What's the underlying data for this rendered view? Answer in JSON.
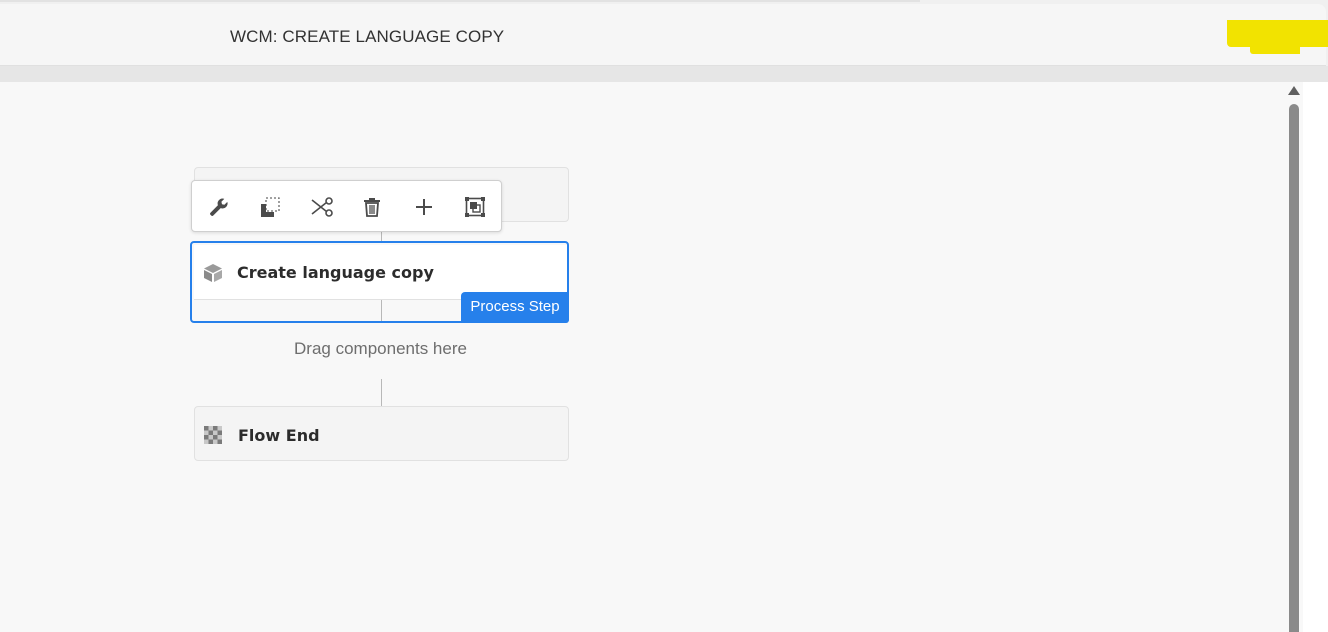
{
  "header": {
    "title": "WCM: CREATE LANGUAGE COPY"
  },
  "toolbar": {
    "actions": [
      {
        "icon": "wrench-icon",
        "tooltip": ""
      },
      {
        "icon": "copy-icon",
        "tooltip": ""
      },
      {
        "icon": "cut-icon",
        "tooltip": ""
      },
      {
        "icon": "trash-icon",
        "tooltip": ""
      },
      {
        "icon": "plus-icon",
        "tooltip": ""
      },
      {
        "icon": "group-icon",
        "tooltip": ""
      }
    ]
  },
  "workflow": {
    "selected_step": {
      "label": "Create language copy",
      "badge": "Process Step",
      "icon": "cube-icon"
    },
    "drop_zone": "Drag components here",
    "end_step": {
      "label": "Flow End",
      "icon": "checkered-flag-icon"
    }
  },
  "colors": {
    "accent": "#2680eb",
    "highlight": "#f2e300"
  }
}
